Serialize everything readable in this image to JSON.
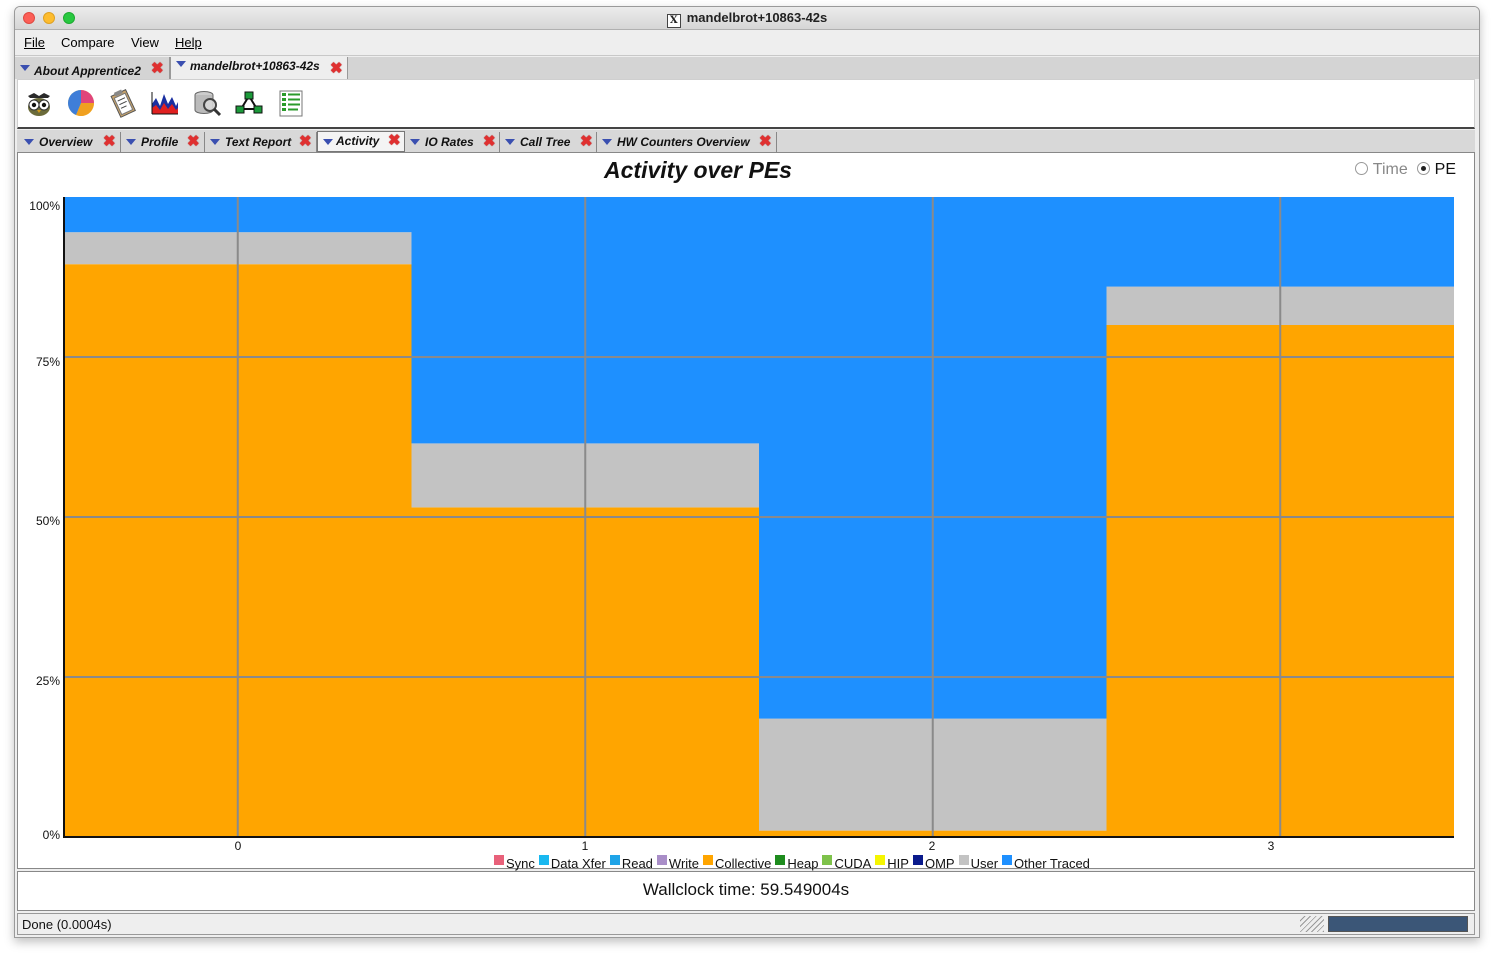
{
  "window": {
    "title": "mandelbrot+10863-42s"
  },
  "menu": [
    "File",
    "Compare",
    "View",
    "Help"
  ],
  "doc_tabs": [
    {
      "label": "About Apprentice2",
      "active": false
    },
    {
      "label": "mandelbrot+10863-42s",
      "active": true
    }
  ],
  "toolbar_icons": [
    "owl-icon",
    "pie-chart-icon",
    "clipboard-report-icon",
    "activity-graph-icon",
    "database-search-icon",
    "call-tree-icon",
    "text-list-icon"
  ],
  "view_tabs": [
    {
      "label": "Overview",
      "active": false
    },
    {
      "label": "Profile",
      "active": false
    },
    {
      "label": "Text Report",
      "active": false
    },
    {
      "label": "Activity",
      "active": true
    },
    {
      "label": "IO Rates",
      "active": false
    },
    {
      "label": "Call Tree",
      "active": false
    },
    {
      "label": "HW Counters Overview",
      "active": false
    }
  ],
  "view_options": {
    "time_label": "Time",
    "pe_label": "PE",
    "selected": "PE"
  },
  "chart_data": {
    "type": "bar",
    "stacked": true,
    "title": "Activity over PEs",
    "categories": [
      "0",
      "1",
      "2",
      "3"
    ],
    "y_tick_labels": [
      "0%",
      "25%",
      "50%",
      "75%",
      "100%"
    ],
    "ylim": [
      0,
      100
    ],
    "grid": true,
    "series": [
      {
        "name": "Sync",
        "color": "#e8617a",
        "values": [
          0,
          0,
          0,
          0
        ]
      },
      {
        "name": "Data Xfer",
        "color": "#19b8f0",
        "values": [
          0,
          0,
          0,
          0
        ]
      },
      {
        "name": "Read",
        "color": "#1fa4e8",
        "values": [
          0,
          0,
          0,
          0
        ]
      },
      {
        "name": "Write",
        "color": "#a98ec8",
        "values": [
          0,
          0,
          0,
          0
        ]
      },
      {
        "name": "Collective",
        "color": "#ffa500",
        "values": [
          89.5,
          51.5,
          1,
          80
        ]
      },
      {
        "name": "Heap",
        "color": "#1e8c1e",
        "values": [
          0,
          0,
          0,
          0
        ]
      },
      {
        "name": "CUDA",
        "color": "#7ec24a",
        "values": [
          0,
          0,
          0,
          0
        ]
      },
      {
        "name": "HIP",
        "color": "#f5f500",
        "values": [
          0,
          0,
          0,
          0
        ]
      },
      {
        "name": "OMP",
        "color": "#0a1a8c",
        "values": [
          0,
          0,
          0,
          0
        ]
      },
      {
        "name": "User",
        "color": "#c3c3c3",
        "values": [
          5,
          10,
          17.5,
          6
        ]
      },
      {
        "name": "Other Traced",
        "color": "#1e90ff",
        "values": [
          5.5,
          38.5,
          81.5,
          14
        ]
      }
    ]
  },
  "footer": {
    "wallclock": "Wallclock time: 59.549004s"
  },
  "status": {
    "text": "Done (0.0004s)"
  }
}
